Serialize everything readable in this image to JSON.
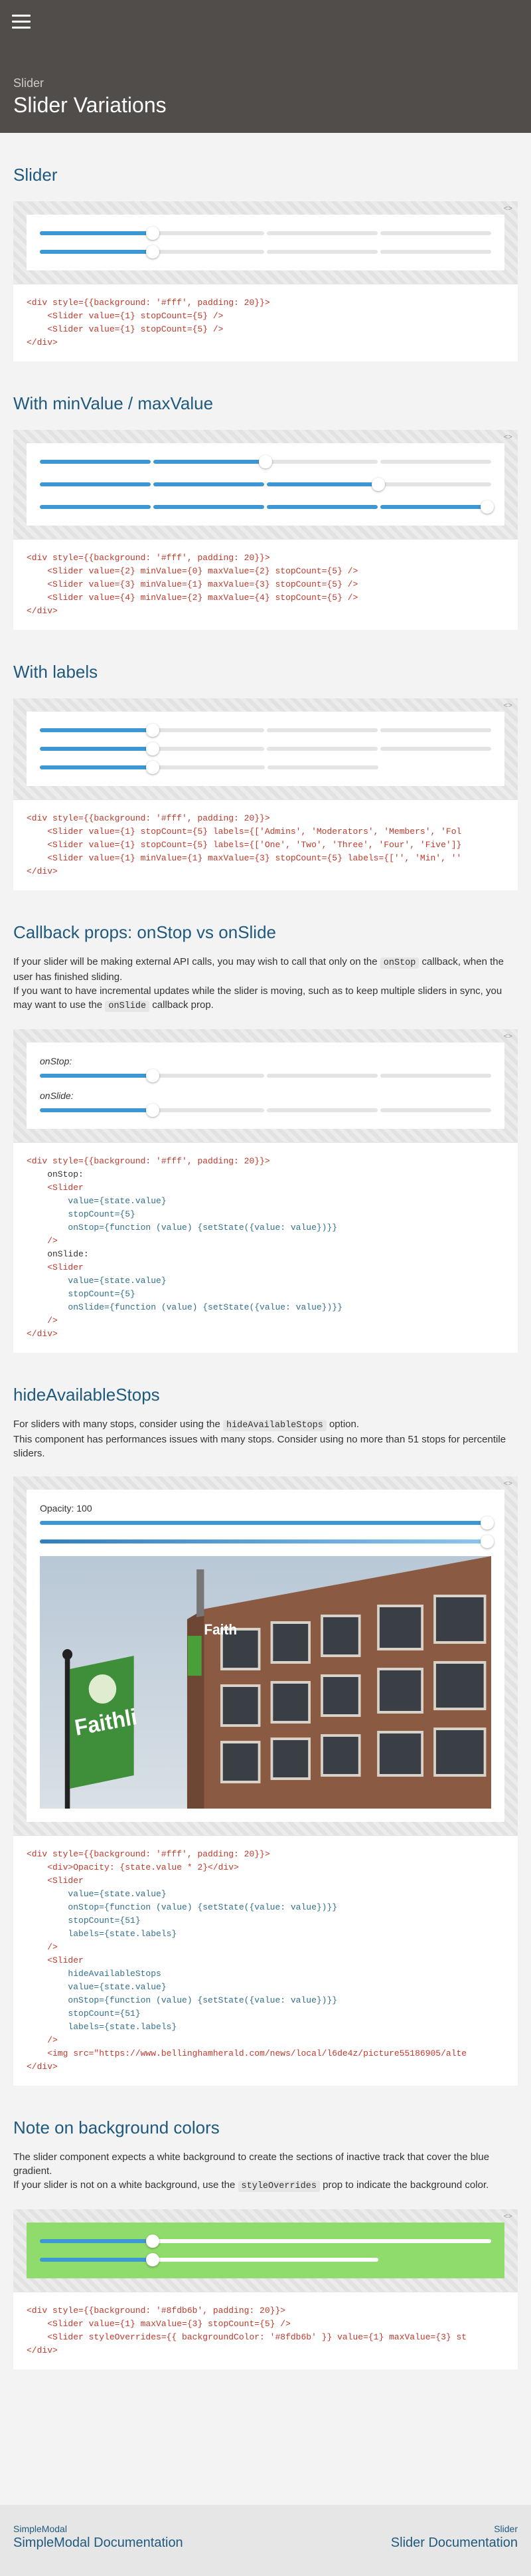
{
  "header": {
    "section": "Slider",
    "title": "Slider Variations",
    "menu_icon": "hamburger-icon"
  },
  "toggle_label": "<>",
  "sections": {
    "basic": {
      "title": "Slider",
      "code": [
        "<div style={{background: '#fff', padding: 20}}>",
        "    <Slider value={1} stopCount={5} />",
        "    <Slider value={1} stopCount={5} />",
        "</div>"
      ]
    },
    "minmax": {
      "title": "With minValue / maxValue",
      "code": [
        "<div style={{background: '#fff', padding: 20}}>",
        "    <Slider value={2} minValue={0} maxValue={2} stopCount={5} />",
        "    <Slider value={3} minValue={1} maxValue={3} stopCount={5} />",
        "    <Slider value={4} minValue={2} maxValue={4} stopCount={5} />",
        "</div>"
      ]
    },
    "labels": {
      "title": "With labels",
      "code": [
        "<div style={{background: '#fff', padding: 20}}>",
        "    <Slider value={1} stopCount={5} labels={['Admins', 'Moderators', 'Members', 'Fol",
        "    <Slider value={1} stopCount={5} labels={['One', 'Two', 'Three', 'Four', 'Five']}",
        "    <Slider value={1} minValue={1} maxValue={3} stopCount={5} labels={['', 'Min', ''",
        "</div>"
      ]
    },
    "callback": {
      "title": "Callback props: onStop vs onSlide",
      "p1_before": "If your slider will be making external API calls, you may wish to call that only on the ",
      "p1_code": "onStop",
      "p1_after": " callback, when the user has finished sliding.",
      "p2_before": "If you want to have incremental updates while the slider is moving, such as to keep multiple sliders in sync, you may want to use the ",
      "p2_code": "onSlide",
      "p2_after": " callback prop.",
      "label_stop": "onStop:",
      "label_slide": "onSlide:",
      "code": [
        "<div style={{background: '#fff', padding: 20}}>",
        "    onStop:",
        "    <Slider",
        "        value={state.value}",
        "        stopCount={5}",
        "        onStop={function (value) {setState({value: value})}}",
        "    />",
        "    onSlide:",
        "    <Slider",
        "        value={state.value}",
        "        stopCount={5}",
        "        onSlide={function (value) {setState({value: value})}}",
        "    />",
        "</div>"
      ]
    },
    "hide": {
      "title": "hideAvailableStops",
      "p1_before": "For sliders with many stops, consider using the ",
      "p1_code": "hideAvailableStops",
      "p1_after": " option.",
      "p2": "This component has performances issues with many stops. Consider using no more than 51 stops for percentile sliders.",
      "opacity_label": "Opacity: 100",
      "code": [
        "<div style={{background: '#fff', padding: 20}}>",
        "    <div>Opacity: {state.value * 2}</div>",
        "    <Slider",
        "        value={state.value}",
        "        onStop={function (value) {setState({value: value})}}",
        "        stopCount={51}",
        "        labels={state.labels}",
        "    />",
        "    <Slider",
        "        hideAvailableStops",
        "        value={state.value}",
        "        onStop={function (value) {setState({value: value})}}",
        "        stopCount={51}",
        "        labels={state.labels}",
        "    />",
        "    <img src=\"https://www.bellinghamherald.com/news/local/l6de4z/picture55186905/alte",
        "</div>"
      ],
      "photo_sign": "Faith",
      "photo_banner": "Faithli"
    },
    "bg": {
      "title": "Note on background colors",
      "p1": "The slider component expects a white background to create the sections of inactive track that cover the blue gradient.",
      "p2_before": "If your slider is not on a white background, use the ",
      "p2_code": "styleOverrides",
      "p2_after": " prop to indicate the background color.",
      "bg_color": "#8fdb6b",
      "code": [
        "<div style={{background: '#8fdb6b', padding: 20}}>",
        "    <Slider value={1} maxValue={3} stopCount={5} />",
        "    <Slider styleOverrides={{ backgroundColor: '#8fdb6b' }} value={1} maxValue={3} st",
        "</div>"
      ]
    }
  },
  "footer": {
    "left_small": "SimpleModal",
    "left_big": "SimpleModal Documentation",
    "right_small": "Slider",
    "right_big": "Slider Documentation"
  },
  "colors": {
    "accent": "#3d97d3",
    "header_bg": "#514d4b",
    "title": "#1f5a7e"
  }
}
